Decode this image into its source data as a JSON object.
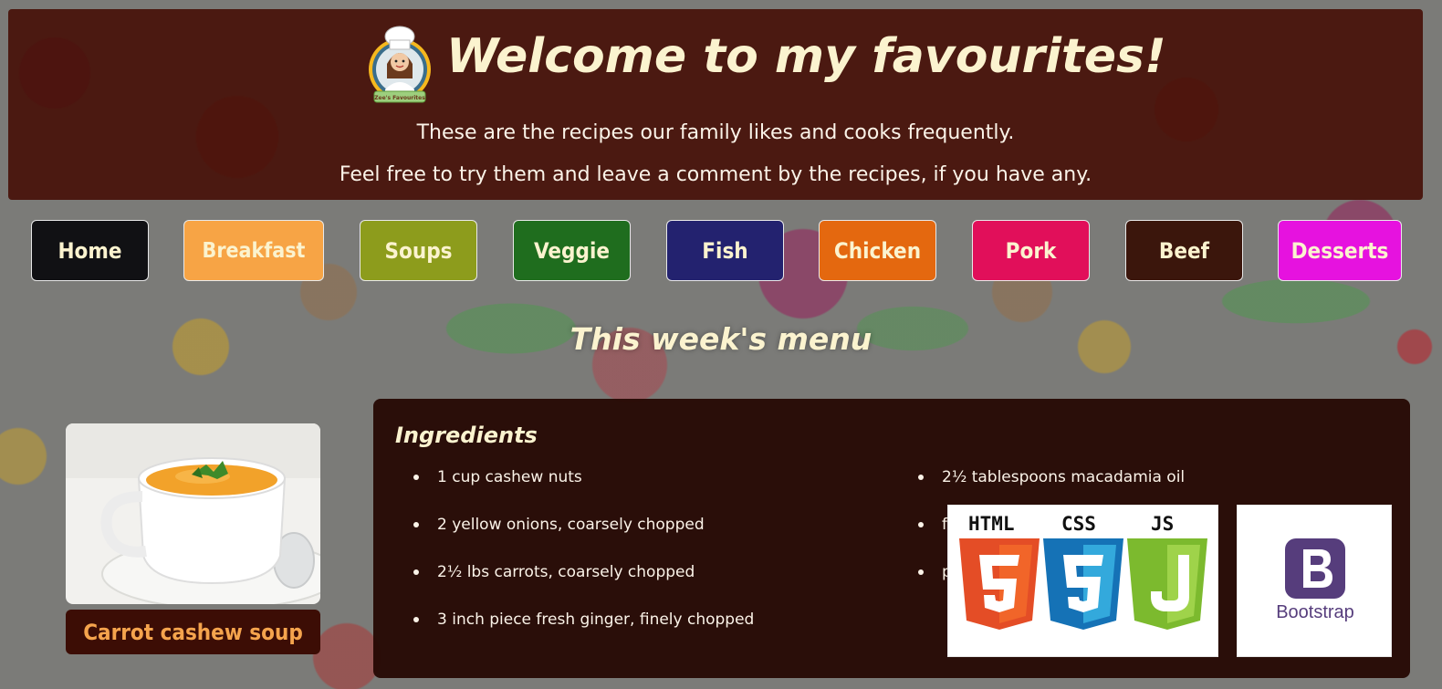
{
  "header": {
    "logo_caption": "Zee's Favourites",
    "title": "Welcome to my favourites!",
    "tagline_1": "These are the recipes our family likes and cooks frequently.",
    "tagline_2": "Feel free to try them and leave a comment by the recipes, if you have any."
  },
  "nav": {
    "items": [
      {
        "label": "Home",
        "color": "#111114"
      },
      {
        "label": "Breakfast",
        "color": "#f7a445"
      },
      {
        "label": "Soups",
        "color": "#8d9c1c"
      },
      {
        "label": "Veggie",
        "color": "#1f6d1e"
      },
      {
        "label": "Fish",
        "color": "#23226f"
      },
      {
        "label": "Chicken",
        "color": "#e4680f"
      },
      {
        "label": "Pork",
        "color": "#e10f5a"
      },
      {
        "label": "Beef",
        "color": "#3b160c"
      },
      {
        "label": "Desserts",
        "color": "#e612df"
      }
    ]
  },
  "menu": {
    "title": "This week's menu",
    "recipe": {
      "name": "Carrot cashew soup"
    },
    "ingredients": {
      "title": "Ingredients",
      "column_1": [
        "1 cup cashew nuts",
        "2 yellow onions, coarsely chopped",
        "2½ lbs carrots, coarsely chopped",
        "3 inch piece fresh ginger, finely chopped"
      ],
      "column_2": [
        "2½ tablespoons macadamia oil",
        "f",
        "p"
      ]
    }
  },
  "tech_badges": {
    "html_label": "HTML",
    "css_label": "CSS",
    "js_label": "JS",
    "bootstrap_label": "Bootstrap"
  },
  "colors": {
    "header_bg": "#460e06",
    "title_cream": "#fbf3cf",
    "recipe_label_orange": "#f5a44d",
    "html5_orange": "#e44d26",
    "css3_blue": "#1572b6",
    "js_green": "#7cba2e",
    "bootstrap_purple": "#563d7c"
  }
}
